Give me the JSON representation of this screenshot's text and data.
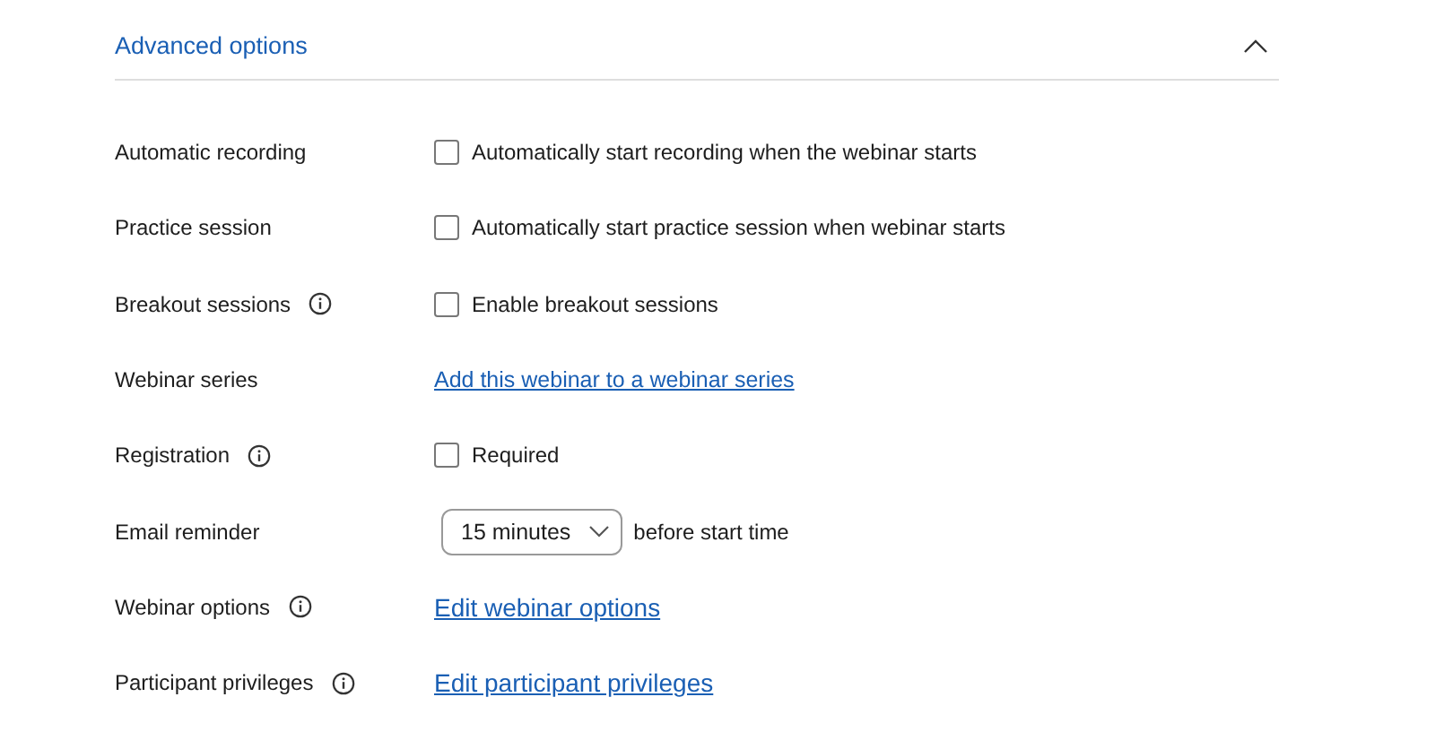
{
  "section": {
    "title": "Advanced options",
    "expanded": true
  },
  "rows": [
    {
      "label": "Automatic recording",
      "info": false,
      "kind": "checkbox",
      "text": "Automatically start recording when the webinar starts",
      "checked": false
    },
    {
      "label": "Practice session",
      "info": false,
      "kind": "checkbox",
      "text": "Automatically start practice session when webinar starts",
      "checked": false
    },
    {
      "label": "Breakout sessions",
      "info": true,
      "kind": "checkbox",
      "text": "Enable breakout sessions",
      "checked": false
    },
    {
      "label": "Webinar series",
      "info": false,
      "kind": "link",
      "text": "Add this webinar to a webinar series"
    },
    {
      "label": "Registration",
      "info": true,
      "kind": "checkbox",
      "text": "Required",
      "checked": false
    },
    {
      "label": "Email reminder",
      "info": false,
      "kind": "select",
      "value": "15 minutes",
      "text": "before start time"
    },
    {
      "label": "Webinar options",
      "info": true,
      "kind": "biglink",
      "text": "Edit webinar options"
    },
    {
      "label": "Participant privileges",
      "info": true,
      "kind": "biglink",
      "text": "Edit participant privileges"
    }
  ]
}
